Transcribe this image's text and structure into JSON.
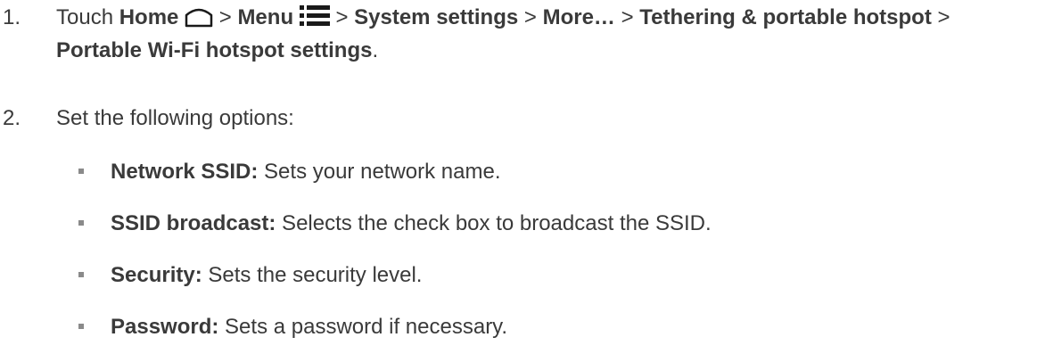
{
  "steps": [
    {
      "number": "1.",
      "text_touch": "Touch",
      "home": "Home",
      "sep1": ">",
      "menu": "Menu",
      "sep2": ">",
      "system_settings": "System settings",
      "sep3": ">",
      "more": "More…",
      "sep4": ">",
      "tethering": "Tethering & portable hotspot",
      "sep5": ">",
      "hotspot_settings": "Portable Wi-Fi hotspot settings",
      "end": "."
    },
    {
      "number": "2.",
      "text": "Set the following options:"
    }
  ],
  "options": [
    {
      "term": "Network SSID:",
      "desc": " Sets your network name."
    },
    {
      "term": "SSID broadcast:",
      "desc": " Selects the check box to broadcast the SSID."
    },
    {
      "term": "Security:",
      "desc": " Sets the security level."
    },
    {
      "term": "Password:",
      "desc": " Sets a password if necessary."
    }
  ],
  "icons": {
    "home": "home-icon",
    "menu": "menu-icon"
  }
}
